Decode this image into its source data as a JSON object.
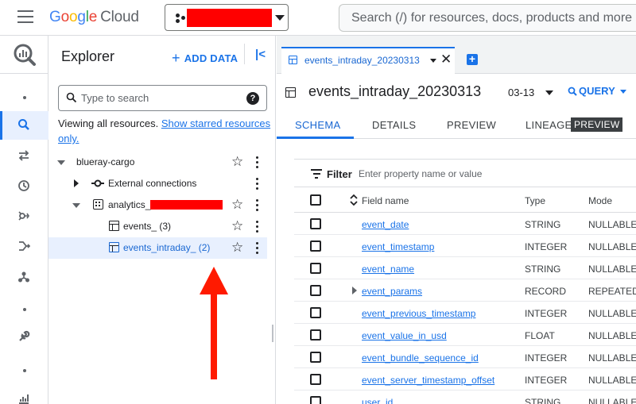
{
  "header": {
    "logo_google": "Google",
    "logo_cloud": "Cloud",
    "search_placeholder": "Search (/) for resources, docs, products and more"
  },
  "rail": {
    "icons": [
      "bigquery-logo-icon",
      "search-icon",
      "transfer-icon",
      "scheduled-queries-icon",
      "analytics-hub-icon",
      "dataflow-icon",
      "pipeline-icon",
      "wrench-icon",
      "chart-icon"
    ]
  },
  "explorer": {
    "title": "Explorer",
    "add_data": "ADD DATA",
    "collapse": "|<",
    "search_placeholder": "Type to search",
    "viewing_text": "Viewing all resources.",
    "starred_link": "Show starred resources only.",
    "tree": {
      "project": "blueray-cargo",
      "external": "External connections",
      "dataset": "analytics_",
      "table_events": "events_ (3)",
      "table_intraday": "events_intraday_ (2)"
    }
  },
  "tab": {
    "label": "events_intraday_20230313",
    "close": "✕",
    "new": "+"
  },
  "table": {
    "title": "events_intraday_20230313",
    "date": "03-13",
    "query_label": "QUERY"
  },
  "subtabs": {
    "schema": "SCHEMA",
    "details": "DETAILS",
    "preview": "PREVIEW",
    "lineage": "LINEAGE",
    "lineage_badge": "PREVIEW"
  },
  "filter": {
    "label": "Filter",
    "placeholder": "Enter property name or value"
  },
  "schema": {
    "headers": {
      "field": "Field name",
      "type": "Type",
      "mode": "Mode"
    },
    "rows": [
      {
        "name": "event_date",
        "type": "STRING",
        "mode": "NULLABLE"
      },
      {
        "name": "event_timestamp",
        "type": "INTEGER",
        "mode": "NULLABLE"
      },
      {
        "name": "event_name",
        "type": "STRING",
        "mode": "NULLABLE"
      },
      {
        "name": "event_params",
        "type": "RECORD",
        "mode": "REPEATED"
      },
      {
        "name": "event_previous_timestamp",
        "type": "INTEGER",
        "mode": "NULLABLE"
      },
      {
        "name": "event_value_in_usd",
        "type": "FLOAT",
        "mode": "NULLABLE"
      },
      {
        "name": "event_bundle_sequence_id",
        "type": "INTEGER",
        "mode": "NULLABLE"
      },
      {
        "name": "event_server_timestamp_offset",
        "type": "INTEGER",
        "mode": "NULLABLE"
      },
      {
        "name": "user_id",
        "type": "STRING",
        "mode": "NULLABLE"
      }
    ]
  },
  "colors": {
    "accent": "#1a73e8",
    "redaction": "#ff0000",
    "arrow": "#ff1a00"
  }
}
